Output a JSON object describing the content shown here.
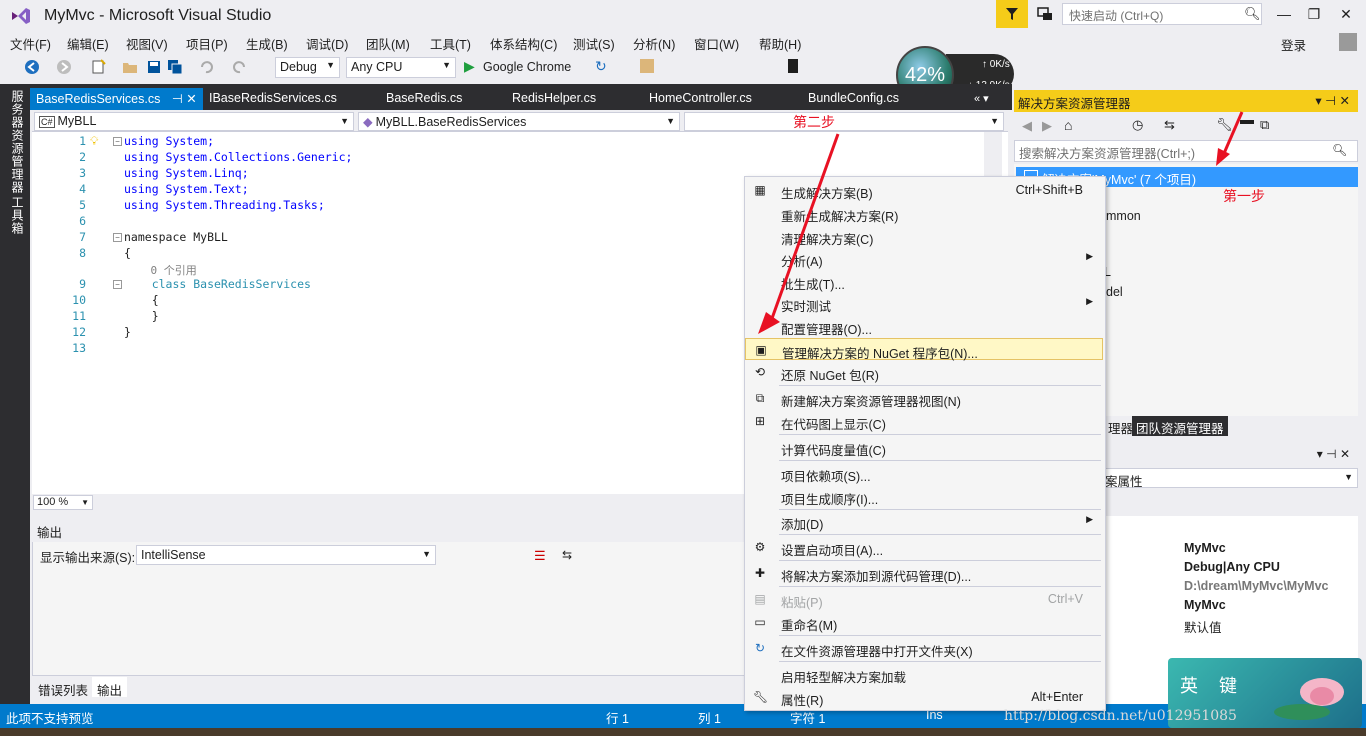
{
  "window": {
    "title": "MyMvc - Microsoft Visual Studio",
    "quick_launch_placeholder": "快速启动 (Ctrl+Q)",
    "login": "登录"
  },
  "menu": [
    "文件(F)",
    "编辑(E)",
    "视图(V)",
    "项目(P)",
    "生成(B)",
    "调试(D)",
    "团队(M)",
    "工具(T)",
    "体系结构(C)",
    "测试(S)",
    "分析(N)",
    "窗口(W)",
    "帮助(H)"
  ],
  "toolbar": {
    "configuration": "Debug",
    "platform": "Any CPU",
    "run_target": "Google Chrome"
  },
  "net_widget": {
    "percent": "42%",
    "up": "0K/s",
    "down": "13.9K/s"
  },
  "left_tabs": [
    "服务器资源管理器",
    "工具箱"
  ],
  "tabs": [
    {
      "label": "BaseRedisServices.cs",
      "active": true
    },
    {
      "label": "IBaseRedisServices.cs"
    },
    {
      "label": "BaseRedis.cs"
    },
    {
      "label": "RedisHelper.cs"
    },
    {
      "label": "HomeController.cs"
    },
    {
      "label": "BundleConfig.cs"
    }
  ],
  "nav": {
    "project": "MyBLL",
    "type": "MyBLL.BaseRedisServices",
    "member": ""
  },
  "code": {
    "line_numbers": [
      "1",
      "2",
      "3",
      "4",
      "5",
      "6",
      "7",
      "8",
      "",
      "9",
      "10",
      "11",
      "12",
      "13"
    ],
    "lines": [
      "using System;",
      "using System.Collections.Generic;",
      "using System.Linq;",
      "using System.Text;",
      "using System.Threading.Tasks;",
      "",
      "namespace MyBLL",
      "{",
      "    0 个引用",
      "    class BaseRedisServices",
      "    {",
      "    }",
      "}",
      ""
    ]
  },
  "zoom": "100 %",
  "output": {
    "title": "输出",
    "source_label": "显示输出来源(S):",
    "source_value": "IntelliSense"
  },
  "bottom_tabs": [
    "错误列表",
    "输出"
  ],
  "status": {
    "message": "此项不支持预览",
    "line": "行 1",
    "col": "列 1",
    "char": "字符 1",
    "mode": "Ins"
  },
  "solution_explorer": {
    "title": "解决方案资源管理器",
    "search_placeholder": "搜索解决方案资源管理器(Ctrl+;)",
    "selected": "解决方案'MyMvc' (7 个项目)",
    "partial_items": [
      "mmon",
      "L",
      "del"
    ],
    "tabs": [
      "理器",
      "团队资源管理器"
    ]
  },
  "properties": {
    "combo_label": "案属性",
    "values": [
      "MyMvc",
      "Debug|Any CPU",
      "D:\\dream\\MyMvc\\MyMvc",
      "MyMvc",
      "默认值"
    ]
  },
  "context_menu": [
    {
      "label": "生成解决方案(B)",
      "shortcut": "Ctrl+Shift+B",
      "icon": "build-icon"
    },
    {
      "label": "重新生成解决方案(R)"
    },
    {
      "label": "清理解决方案(C)"
    },
    {
      "label": "分析(A)",
      "submenu": true
    },
    {
      "label": "批生成(T)..."
    },
    {
      "label": "实时测试",
      "submenu": true
    },
    {
      "label": "配置管理器(O)..."
    },
    {
      "label": "管理解决方案的 NuGet 程序包(N)...",
      "highlight": true,
      "icon": "nuget-icon"
    },
    {
      "label": "还原 NuGet 包(R)",
      "icon": "restore-icon"
    },
    {
      "label": "新建解决方案资源管理器视图(N)",
      "icon": "new-view-icon"
    },
    {
      "label": "在代码图上显示(C)",
      "icon": "code-map-icon"
    },
    {
      "label": "计算代码度量值(C)"
    },
    {
      "label": "项目依赖项(S)..."
    },
    {
      "label": "项目生成顺序(I)..."
    },
    {
      "label": "添加(D)",
      "submenu": true
    },
    {
      "label": "设置启动项目(A)...",
      "icon": "gear-icon"
    },
    {
      "label": "将解决方案添加到源代码管理(D)...",
      "icon": "source-control-icon"
    },
    {
      "label": "粘贴(P)",
      "shortcut": "Ctrl+V",
      "disabled": true,
      "icon": "paste-icon"
    },
    {
      "label": "重命名(M)",
      "icon": "rename-icon"
    },
    {
      "label": "在文件资源管理器中打开文件夹(X)",
      "icon": "open-folder-icon"
    },
    {
      "label": "启用轻型解决方案加载"
    },
    {
      "label": "属性(R)",
      "shortcut": "Alt+Enter",
      "icon": "wrench-icon"
    }
  ],
  "annotations": {
    "step1": "第一步",
    "step2": "第二步"
  },
  "badge_text": "英 键",
  "watermark": "http://blog.csdn.net/u012951085",
  "colors": {
    "accent": "#007acc",
    "chrome": "#2d2d30",
    "highlight": "#fff8c6",
    "annotation": "#e81123",
    "selection": "#3399ff"
  }
}
